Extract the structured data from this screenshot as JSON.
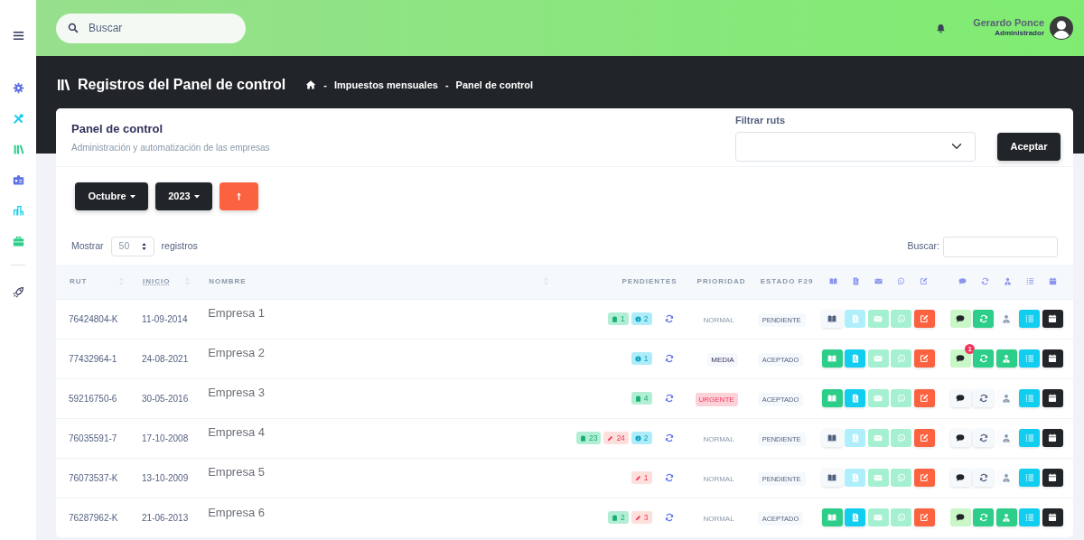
{
  "search": {
    "placeholder": "Buscar"
  },
  "user": {
    "name": "Gerardo Ponce",
    "role": "Administrador"
  },
  "page_title": "Registros del Panel de control",
  "breadcrumb": [
    {
      "separator": "-",
      "label": "Impuestos mensuales"
    },
    {
      "separator": "-",
      "label": "Panel de control"
    }
  ],
  "card": {
    "title": "Panel de control",
    "subtitle": "Administración y automatización de las empresas"
  },
  "filter": {
    "label": "Filtrar ruts",
    "button": "Aceptar"
  },
  "month": "Octubre",
  "year": "2023",
  "length": {
    "before": "Mostrar",
    "value": "50",
    "after": "registros"
  },
  "table_search": {
    "label": "Buscar:"
  },
  "table": {
    "columns": [
      {
        "label": "RUT",
        "sorted": false
      },
      {
        "label": "INICIO",
        "sorted": true
      },
      {
        "label": "NOMBRE",
        "sorted": false
      },
      {
        "label": "PENDIENTES",
        "sorted": false
      },
      {
        "label": "PRIORIDAD",
        "sorted": false
      },
      {
        "label": "ESTADO F29",
        "sorted": false
      }
    ],
    "rows": [
      {
        "rut": "76424804-K",
        "inicio": "11-09-2014",
        "nombre": "Empresa 1",
        "pendientes": [
          {
            "kind": "docs",
            "count": "1"
          },
          {
            "kind": "info",
            "count": "2"
          }
        ],
        "prioridad": {
          "kind": "normal",
          "text": "NORMAL"
        },
        "estado": "PENDIENTE",
        "book": false,
        "pdf": false,
        "chat": true,
        "sync": true,
        "user": false
      },
      {
        "rut": "77432964-1",
        "inicio": "24-08-2021",
        "nombre": "Empresa 2",
        "pendientes": [
          {
            "kind": "info",
            "count": "1"
          }
        ],
        "prioridad": {
          "kind": "media",
          "text": "MEDIA"
        },
        "estado": "ACEPTADO",
        "book": true,
        "pdf": true,
        "chat": true,
        "chat_badge": "1",
        "sync": true,
        "user": true
      },
      {
        "rut": "59216750-6",
        "inicio": "30-05-2016",
        "nombre": "Empresa 3",
        "pendientes": [
          {
            "kind": "docs",
            "count": "4"
          }
        ],
        "prioridad": {
          "kind": "urgente",
          "text": "URGENTE"
        },
        "estado": "ACEPTADO",
        "book": true,
        "pdf": true,
        "chat": false,
        "sync": false,
        "user": false
      },
      {
        "rut": "76035591-7",
        "inicio": "17-10-2008",
        "nombre": "Empresa 4",
        "pendientes": [
          {
            "kind": "docs",
            "count": "23"
          },
          {
            "kind": "edit",
            "count": "24"
          },
          {
            "kind": "info",
            "count": "2"
          }
        ],
        "prioridad": {
          "kind": "normal",
          "text": "NORMAL"
        },
        "estado": "PENDIENTE",
        "book": false,
        "pdf": false,
        "chat": false,
        "sync": false,
        "user": false
      },
      {
        "rut": "76073537-K",
        "inicio": "13-10-2009",
        "nombre": "Empresa 5",
        "pendientes": [
          {
            "kind": "edit",
            "count": "1"
          }
        ],
        "prioridad": {
          "kind": "normal",
          "text": "NORMAL"
        },
        "estado": "PENDIENTE",
        "book": false,
        "pdf": false,
        "chat": false,
        "sync": false,
        "user": false
      },
      {
        "rut": "76287962-K",
        "inicio": "21-06-2013",
        "nombre": "Empresa 6",
        "pendientes": [
          {
            "kind": "docs",
            "count": "2"
          },
          {
            "kind": "edit",
            "count": "3"
          }
        ],
        "prioridad": {
          "kind": "normal",
          "text": "NORMAL"
        },
        "estado": "ACEPTADO",
        "book": true,
        "pdf": true,
        "chat": true,
        "sync": true,
        "user": true
      }
    ]
  }
}
